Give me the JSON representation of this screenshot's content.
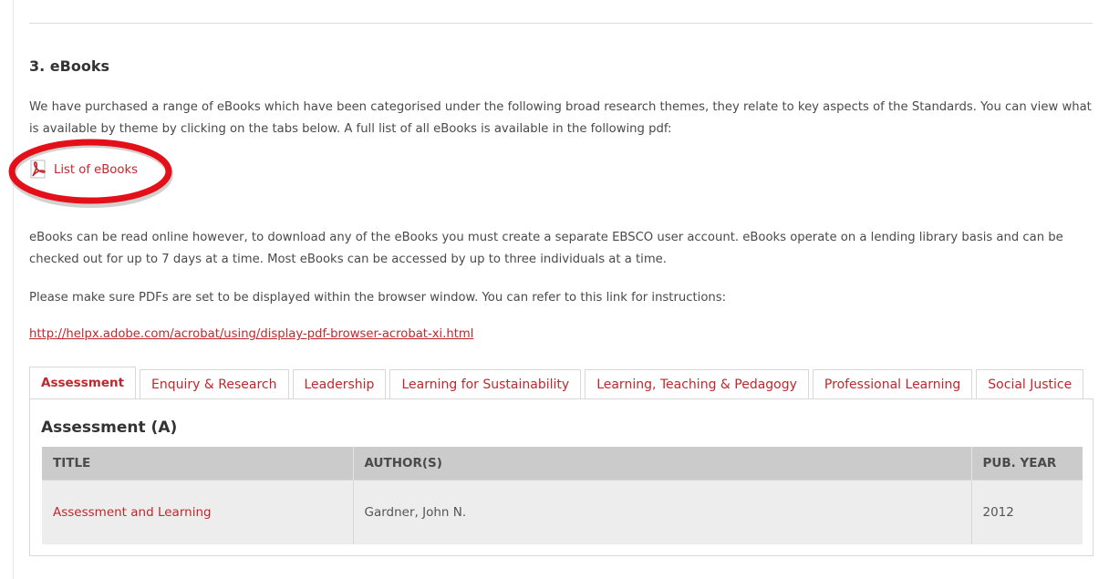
{
  "section": {
    "title": "3. eBooks",
    "intro": "We have purchased a range of eBooks which have been categorised under the following broad research themes, they relate to key aspects of the Standards. You can view what is available by theme by clicking on the tabs below. A full list of all eBooks is available in the following pdf:",
    "pdf_link": {
      "label": "List of eBooks",
      "icon": "pdf-icon"
    },
    "download_note": "eBooks can be read online however, to download any of the eBooks you must create a separate EBSCO user account. eBooks operate on a lending library basis and can be checked out for up to 7 days at a time. Most eBooks can be accessed by up to three individuals at a time.",
    "browser_note": "Please make sure PDFs are set to be displayed within the browser window. You can refer to this link for instructions:",
    "help_url": "http://helpx.adobe.com/acrobat/using/display-pdf-browser-acrobat-xi.html"
  },
  "tabs": [
    {
      "label": "Assessment",
      "active": true
    },
    {
      "label": "Enquiry & Research",
      "active": false
    },
    {
      "label": "Leadership",
      "active": false
    },
    {
      "label": "Learning for Sustainability",
      "active": false
    },
    {
      "label": "Learning, Teaching & Pedagogy",
      "active": false
    },
    {
      "label": "Professional Learning",
      "active": false
    },
    {
      "label": "Social Justice",
      "active": false
    }
  ],
  "panel": {
    "title": "Assessment (A)",
    "columns": [
      "TITLE",
      "AUTHOR(S)",
      "PUB. YEAR"
    ],
    "rows": [
      {
        "title": "Assessment and Learning",
        "authors": "Gardner, John N.",
        "year": "2012"
      }
    ]
  },
  "colors": {
    "link": "#c0272d",
    "highlight_ring": "#e3101a",
    "table_header": "#cbcbcb",
    "table_row": "#ededed"
  }
}
